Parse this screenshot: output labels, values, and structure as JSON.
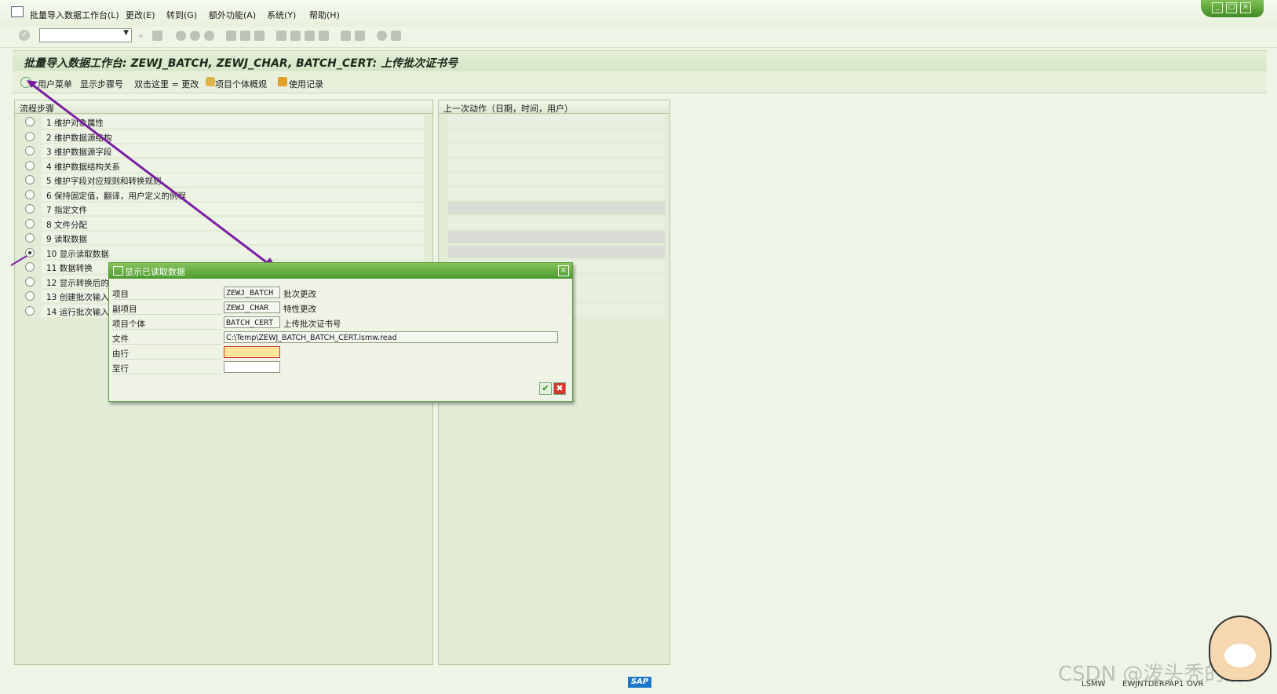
{
  "menu": {
    "items": [
      "批量导入数据工作台(L)",
      "更改(E)",
      "转到(G)",
      "额外功能(A)",
      "系统(Y)",
      "帮助(H)"
    ]
  },
  "window_controls": [
    "_",
    "□",
    "×"
  ],
  "toolbar": {
    "command_field": ""
  },
  "title": "批量导入数据工作台: ZEWJ_BATCH, ZEWJ_CHAR, BATCH_CERT: 上传批次证书号",
  "app_toolbar": {
    "user_menu": "用户菜单",
    "show_step_number": "显示步骤号",
    "double_click": "双击这里 = 更改",
    "object_overview": "项目个体概观",
    "usage_log": "使用记录"
  },
  "steps_panel": {
    "header": "流程步骤",
    "steps": [
      "1 维护对象属性",
      "2 维护数据源结构",
      "3 维护数据源字段",
      "4 维护数据结构关系",
      "5 维护字段对应规则和转换规则",
      "6 保持固定值，翻译，用户定义的例程",
      "7 指定文件",
      "8 文件分配",
      "9 读取数据",
      "10 显示读取数据",
      "11 数据转换",
      "12 显示转换后的数",
      "13 创建批次输入",
      "14 运行批次输入"
    ],
    "selected_index": 9
  },
  "last_action_panel": {
    "header": "上一次动作（日期，时间，用户）"
  },
  "dialog": {
    "title": "显示已读取数据",
    "fields": [
      {
        "label": "项目",
        "value": "ZEWJ_BATCH",
        "desc": "批次更改"
      },
      {
        "label": "副项目",
        "value": "ZEWJ_CHAR",
        "desc": "特性更改"
      },
      {
        "label": "项目个体",
        "value": "BATCH_CERT",
        "desc": "上传批次证书号"
      },
      {
        "label": "文件",
        "value": "C:\\Temp\\ZEWJ_BATCH_BATCH_CERT.lsmw.read",
        "desc": ""
      },
      {
        "label": "由行",
        "value": "",
        "desc": ""
      },
      {
        "label": "至行",
        "value": "",
        "desc": ""
      }
    ],
    "ok": "✔",
    "cancel": "✖"
  },
  "status": {
    "sap_logo": "SAP",
    "transaction": "LSMW",
    "server": "EWJNTDERPAP1",
    "mode": "OVR",
    "watermark": "CSDN @泼头秃的清"
  },
  "colors": {
    "accent_green": "#4c9a30",
    "arrow_purple": "#7a1fa2",
    "background": "#eef4e6"
  }
}
